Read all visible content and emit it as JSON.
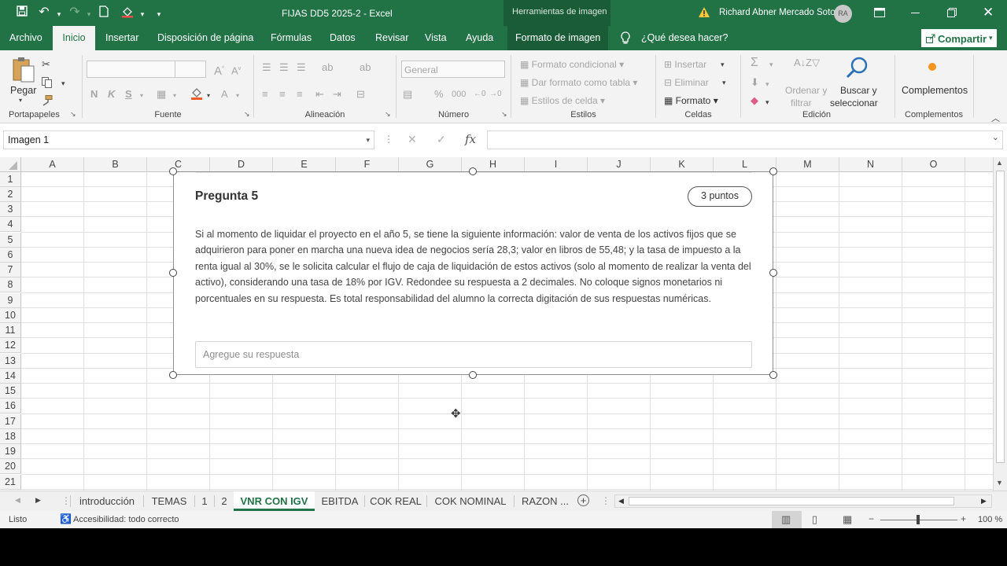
{
  "titlebar": {
    "title": "FIJAS DD5 2025-2  -  Excel",
    "context_tab": "Herramientas de imagen",
    "user_name": "Richard Abner Mercado Soto",
    "user_initials": "RA"
  },
  "ribbon_tabs": [
    "Archivo",
    "Inicio",
    "Insertar",
    "Disposición de página",
    "Fórmulas",
    "Datos",
    "Revisar",
    "Vista",
    "Ayuda",
    "Formato de imagen"
  ],
  "tell_me": "¿Qué desea hacer?",
  "share_label": "Compartir",
  "ribbon": {
    "clipboard": {
      "paste": "Pegar",
      "label": "Portapapeles"
    },
    "font": {
      "label": "Fuente",
      "bold": "N",
      "italic": "K",
      "underline": "S"
    },
    "alignment": {
      "label": "Alineación"
    },
    "number": {
      "format": "General",
      "label": "Número"
    },
    "styles": {
      "conditional": "Formato condicional",
      "as_table": "Dar formato como tabla",
      "cell_styles": "Estilos de celda",
      "label": "Estilos"
    },
    "cells": {
      "insert": "Insertar",
      "delete": "Eliminar",
      "format": "Formato",
      "label": "Celdas"
    },
    "editing": {
      "sort_line1": "Ordenar y",
      "sort_line2": "filtrar",
      "find_line1": "Buscar y",
      "find_line2": "seleccionar",
      "label": "Edición"
    },
    "addins": {
      "button": "Complementos",
      "label": "Complementos"
    }
  },
  "formula_bar": {
    "name_box": "Imagen 1",
    "formula": ""
  },
  "columns": [
    "A",
    "B",
    "C",
    "D",
    "E",
    "F",
    "G",
    "H",
    "I",
    "J",
    "K",
    "L",
    "M",
    "N",
    "O"
  ],
  "rows": [
    "1",
    "2",
    "3",
    "4",
    "5",
    "6",
    "7",
    "8",
    "9",
    "10",
    "11",
    "12",
    "13",
    "14",
    "15",
    "16",
    "17",
    "18",
    "19",
    "20",
    "21"
  ],
  "question": {
    "title": "Pregunta 5",
    "points": "3 puntos",
    "body": "Si al momento de liquidar el proyecto en el año 5, se tiene la siguiente información: valor de venta de los activos fijos que se adquirieron para poner en marcha una nueva idea de negocios sería 28,3; valor en libros de 55,48; y la tasa de impuesto a la renta igual al 30%, se le solicita calcular el flujo de caja de liquidación de estos activos (solo al momento de realizar la venta del activo), considerando una tasa de 18% por IGV. Redondee su respuesta a 2 decimales. No coloque signos monetarios ni porcentuales en su respuesta. Es total responsabilidad del alumno la correcta digitación de sus respuestas numéricas.",
    "answer_placeholder": "Agregue su respuesta"
  },
  "sheet_tabs": [
    "introducción",
    "TEMAS",
    "1",
    "2",
    "VNR CON IGV",
    "EBITDA",
    "COK REAL",
    "COK NOMINAL",
    "RAZON ..."
  ],
  "active_sheet": "VNR CON IGV",
  "status": {
    "ready": "Listo",
    "accessibility": "Accesibilidad: todo correcto",
    "zoom": "100 %"
  },
  "colors": {
    "excel_green": "#217346",
    "ribbon_bg": "#f3f3f3"
  }
}
